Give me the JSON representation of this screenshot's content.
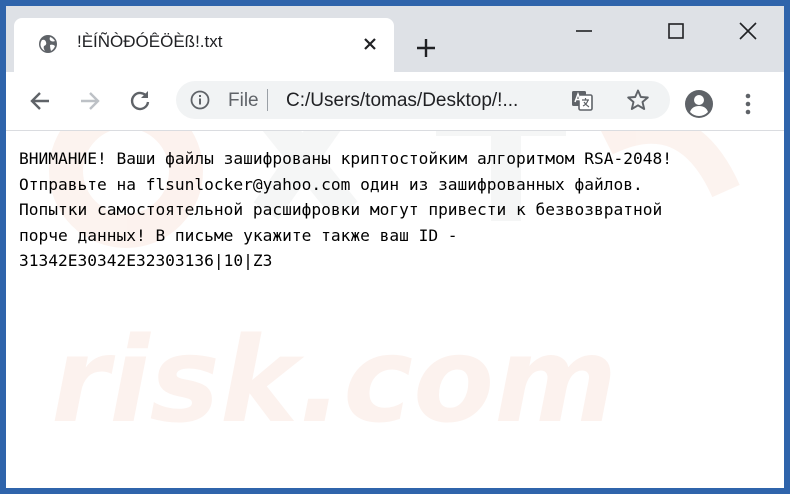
{
  "tab": {
    "title": "!ÈÍÑÒÐÓÊÖÈß!.txt",
    "favicon": "globe-icon"
  },
  "window_controls": [
    "minimize-icon",
    "maximize-icon",
    "close-icon"
  ],
  "toolbar": {
    "back": "back-arrow-icon",
    "forward": "forward-arrow-icon",
    "reload": "reload-icon",
    "scheme_label": "File",
    "url": "C:/Users/tomas/Desktop/!...",
    "translate": "translate-icon",
    "bookmark": "star-icon",
    "profile": "avatar-icon",
    "menu": "kebab-menu-icon"
  },
  "document": {
    "lines": [
      "ВНИМАНИЕ! Ваши файлы зашифрованы криптостойким алгоритмом RSA-2048!",
      "Отправьте на flsunlocker@yahoo.com один из зашифрованных файлов.",
      "Попытки самостоятельной расшифровки могут привести к безвозвратной",
      "порче данных! В письме укажите также ваш ID -",
      "31342E30342E32303136|10|Z3"
    ]
  },
  "watermark": {
    "text": "risk.com"
  },
  "colors": {
    "frame": "#2f64ab",
    "tabstrip": "#dee1e6",
    "omnibox": "#f1f3f4",
    "icon": "#5f6368"
  }
}
